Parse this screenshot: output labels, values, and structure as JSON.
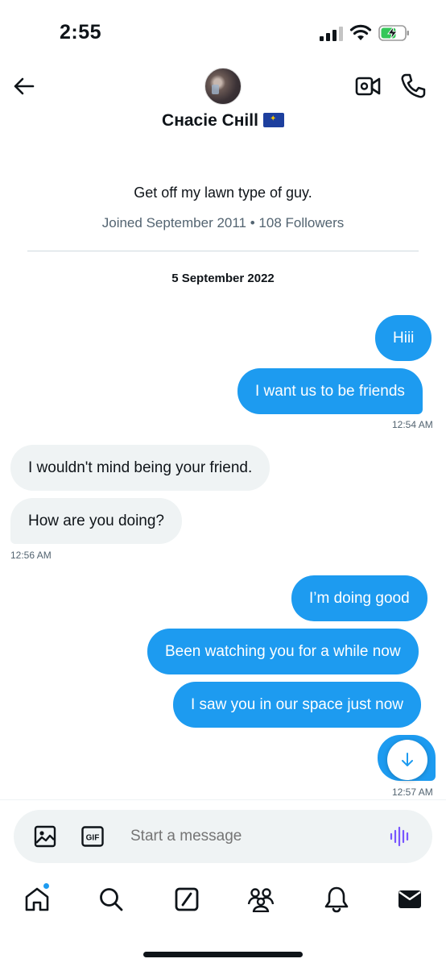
{
  "status_bar": {
    "time": "2:55"
  },
  "header": {
    "name": "Cнacie Cнill",
    "flag_icon": "eu-flag"
  },
  "profile": {
    "bio": "Get off my lawn type of guy.",
    "joined": "Joined September 2011 • 108 Followers"
  },
  "date_separator": "5 September 2022",
  "messages": [
    {
      "text": "Hiii",
      "direction": "sent"
    },
    {
      "text": "I want us to be friends",
      "direction": "sent",
      "time": "12:54 AM"
    },
    {
      "text": "I wouldn't mind being your friend.",
      "direction": "received"
    },
    {
      "text": "How are you doing?",
      "direction": "received",
      "time": "12:56 AM"
    },
    {
      "text": "I’m doing good",
      "direction": "sent"
    },
    {
      "text": "Been watching you for a while now",
      "direction": "sent"
    },
    {
      "text": "I saw you in our space just now",
      "direction": "sent"
    },
    {
      "text": "",
      "direction": "sent",
      "time": "12:57 AM"
    }
  ],
  "composer": {
    "placeholder": "Start a message",
    "gif_label": "GIF"
  },
  "tabs": [
    "home-icon",
    "search-icon",
    "grok-icon",
    "communities-icon",
    "notifications-icon",
    "messages-icon"
  ],
  "colors": {
    "accent": "#1d9bf0",
    "received_bubble": "#eff3f4",
    "muted_text": "#536471",
    "voice_icon": "#7856ff"
  }
}
